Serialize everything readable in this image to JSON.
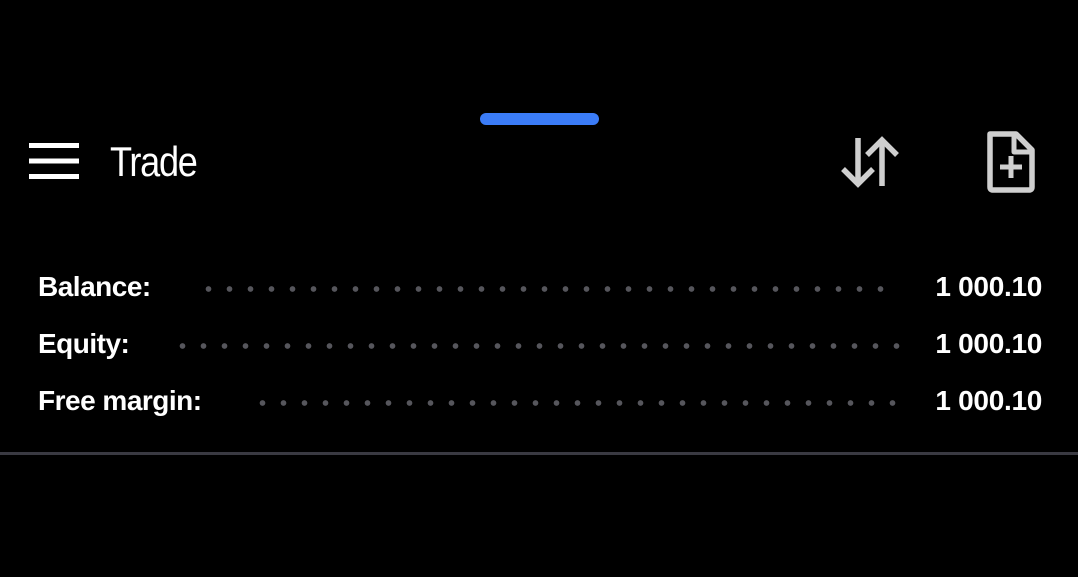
{
  "colors": {
    "accent": "#3b7cf7",
    "background": "#000000",
    "text": "#ffffff",
    "icon": "#cfcfcf",
    "divider": "#3a3a42",
    "dots": "#56565c"
  },
  "header": {
    "title": "Trade",
    "menu_icon": "hamburger-menu-icon",
    "sort_icon": "sort-arrows-icon",
    "new_order_icon": "add-document-icon"
  },
  "summary": {
    "rows": [
      {
        "label": "Balance:",
        "value": "1 000.10"
      },
      {
        "label": "Equity:",
        "value": "1 000.10"
      },
      {
        "label": "Free margin:",
        "value": "1 000.10"
      }
    ]
  }
}
